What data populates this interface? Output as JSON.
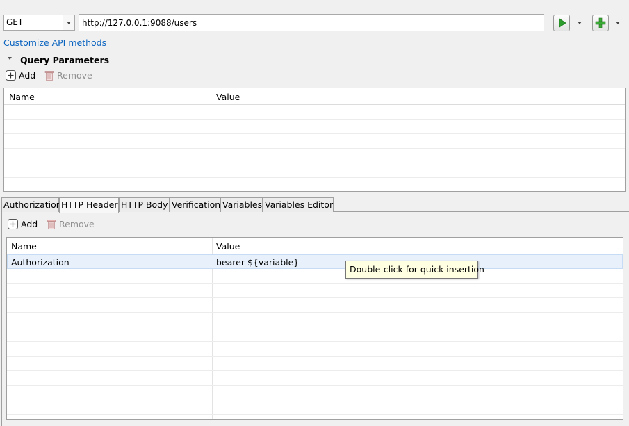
{
  "request": {
    "method": "GET",
    "url": "http://127.0.0.1:9088/users"
  },
  "links": {
    "customize": "Customize API methods"
  },
  "query_params": {
    "title": "Query Parameters",
    "add_label": "Add",
    "remove_label": "Remove",
    "columns": [
      "Name",
      "Value"
    ],
    "rows": []
  },
  "tabs": [
    {
      "label": "Authorization",
      "active": false
    },
    {
      "label": "HTTP Header",
      "active": true
    },
    {
      "label": "HTTP Body",
      "active": false
    },
    {
      "label": "Verification",
      "active": false
    },
    {
      "label": "Variables",
      "active": false
    },
    {
      "label": "Variables Editor",
      "active": false
    }
  ],
  "http_header": {
    "add_label": "Add",
    "remove_label": "Remove",
    "columns": [
      "Name",
      "Value"
    ],
    "rows": [
      {
        "name": "Authorization",
        "value": "bearer ${variable}"
      }
    ]
  },
  "tooltip": {
    "text": "Double-click for quick insertion"
  },
  "colors": {
    "link": "#0b64c0",
    "run_green": "#2e9e2e",
    "add_green": "#3aa935",
    "tooltip_bg": "#ffffe1",
    "selection": "#e8f1fb"
  },
  "icons": {
    "run": "play-icon",
    "add_request": "plus-icon",
    "add": "add-square-icon",
    "remove": "trash-icon"
  }
}
